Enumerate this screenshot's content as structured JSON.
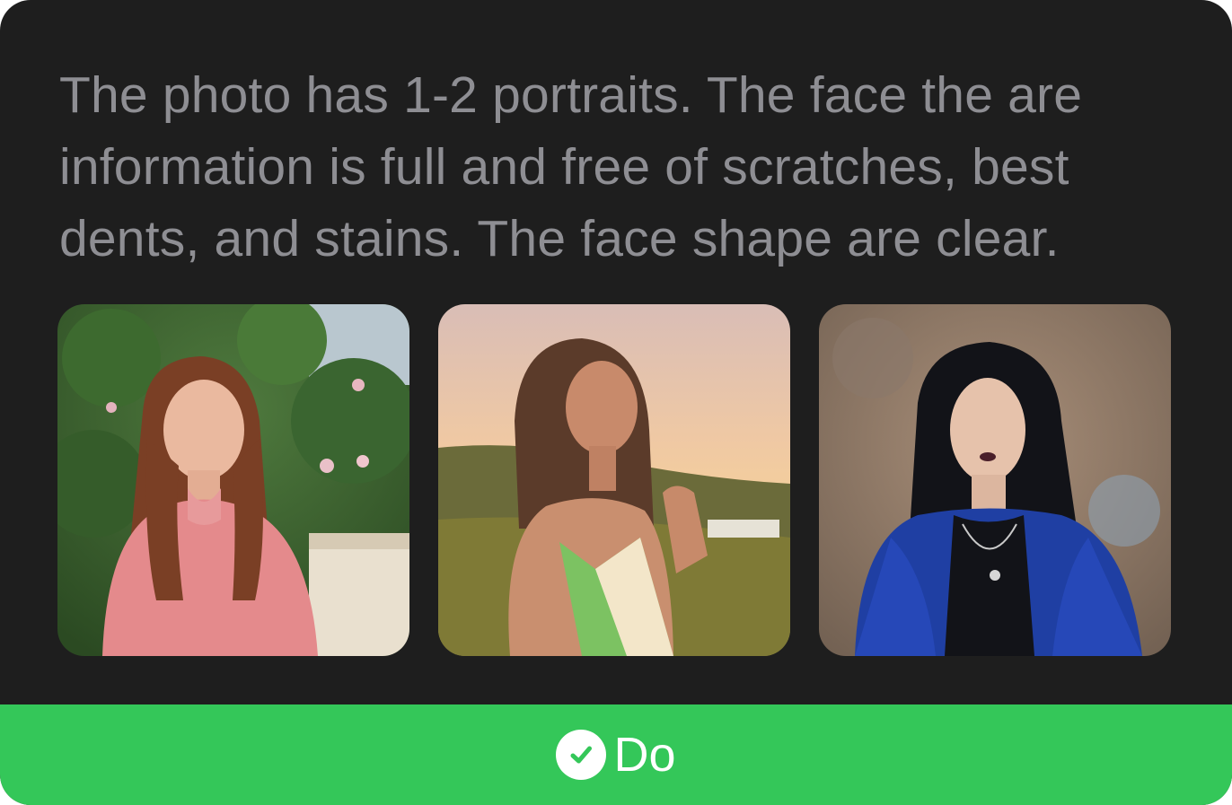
{
  "description": {
    "line1": "The photo has 1-2 portraits. The face the are",
    "line2": "information is full and free of scratches, best",
    "line3": "dents, and stains. The face shape are clear."
  },
  "photos": [
    {
      "icon": "portrait-photo"
    },
    {
      "icon": "portrait-photo"
    },
    {
      "icon": "portrait-photo"
    }
  ],
  "footer": {
    "label": "Do",
    "icon": "checkmark-circle-icon",
    "color": "#34c759"
  }
}
